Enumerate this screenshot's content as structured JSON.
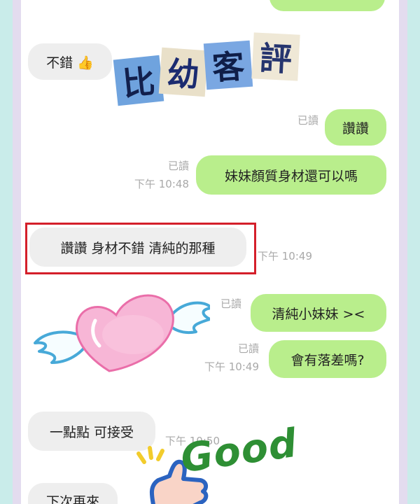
{
  "title": {
    "chars": [
      "比",
      "幼",
      "客",
      "評"
    ]
  },
  "sticker": {
    "good": "Good"
  },
  "messages": [
    {
      "side": "in",
      "text": "不錯 👍"
    },
    {
      "side": "out",
      "text": "讚讚",
      "read": "已讀"
    },
    {
      "side": "out",
      "text": "妹妹顏質身材還可以嗎",
      "read": "已讀",
      "time": "下午 10:48"
    },
    {
      "side": "in",
      "text": "讚讚 身材不錯  清純的那種",
      "time": "下午 10:49"
    },
    {
      "side": "out",
      "text": "清純小妹妹 ><",
      "read": "已讀"
    },
    {
      "side": "out",
      "text": "會有落差嗎?",
      "read": "已讀",
      "time": "下午 10:49"
    },
    {
      "side": "in",
      "text": "一點點 可接受",
      "time": "下午 10:50"
    },
    {
      "side": "in",
      "text": "下次再來"
    }
  ]
}
